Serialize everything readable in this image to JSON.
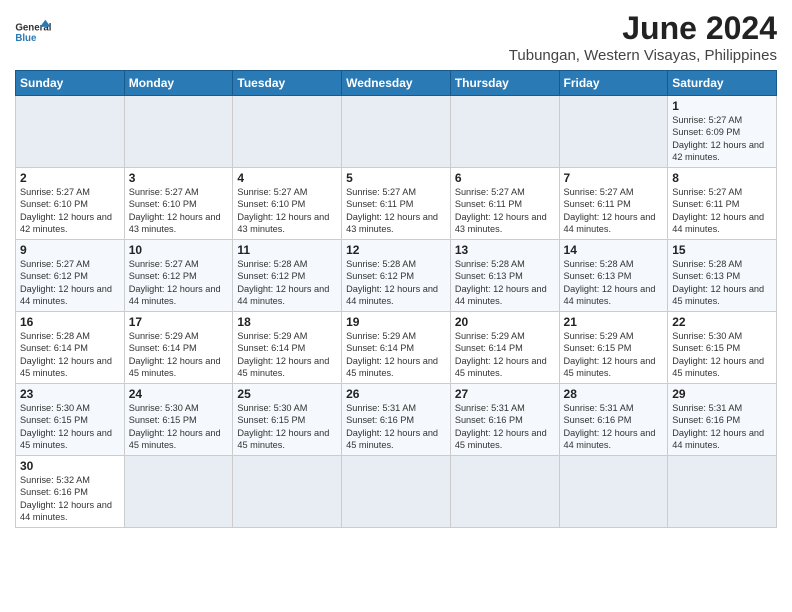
{
  "header": {
    "logo_general": "General",
    "logo_blue": "Blue",
    "month": "June 2024",
    "location": "Tubungan, Western Visayas, Philippines"
  },
  "days_of_week": [
    "Sunday",
    "Monday",
    "Tuesday",
    "Wednesday",
    "Thursday",
    "Friday",
    "Saturday"
  ],
  "weeks": [
    [
      {
        "day": "",
        "info": ""
      },
      {
        "day": "",
        "info": ""
      },
      {
        "day": "",
        "info": ""
      },
      {
        "day": "",
        "info": ""
      },
      {
        "day": "",
        "info": ""
      },
      {
        "day": "",
        "info": ""
      },
      {
        "day": "1",
        "info": "Sunrise: 5:27 AM\nSunset: 6:09 PM\nDaylight: 12 hours and 42 minutes."
      }
    ],
    [
      {
        "day": "2",
        "info": "Sunrise: 5:27 AM\nSunset: 6:10 PM\nDaylight: 12 hours and 42 minutes."
      },
      {
        "day": "3",
        "info": "Sunrise: 5:27 AM\nSunset: 6:10 PM\nDaylight: 12 hours and 43 minutes."
      },
      {
        "day": "4",
        "info": "Sunrise: 5:27 AM\nSunset: 6:10 PM\nDaylight: 12 hours and 43 minutes."
      },
      {
        "day": "5",
        "info": "Sunrise: 5:27 AM\nSunset: 6:11 PM\nDaylight: 12 hours and 43 minutes."
      },
      {
        "day": "6",
        "info": "Sunrise: 5:27 AM\nSunset: 6:11 PM\nDaylight: 12 hours and 43 minutes."
      },
      {
        "day": "7",
        "info": "Sunrise: 5:27 AM\nSunset: 6:11 PM\nDaylight: 12 hours and 44 minutes."
      },
      {
        "day": "8",
        "info": "Sunrise: 5:27 AM\nSunset: 6:11 PM\nDaylight: 12 hours and 44 minutes."
      }
    ],
    [
      {
        "day": "9",
        "info": "Sunrise: 5:27 AM\nSunset: 6:12 PM\nDaylight: 12 hours and 44 minutes."
      },
      {
        "day": "10",
        "info": "Sunrise: 5:27 AM\nSunset: 6:12 PM\nDaylight: 12 hours and 44 minutes."
      },
      {
        "day": "11",
        "info": "Sunrise: 5:28 AM\nSunset: 6:12 PM\nDaylight: 12 hours and 44 minutes."
      },
      {
        "day": "12",
        "info": "Sunrise: 5:28 AM\nSunset: 6:12 PM\nDaylight: 12 hours and 44 minutes."
      },
      {
        "day": "13",
        "info": "Sunrise: 5:28 AM\nSunset: 6:13 PM\nDaylight: 12 hours and 44 minutes."
      },
      {
        "day": "14",
        "info": "Sunrise: 5:28 AM\nSunset: 6:13 PM\nDaylight: 12 hours and 44 minutes."
      },
      {
        "day": "15",
        "info": "Sunrise: 5:28 AM\nSunset: 6:13 PM\nDaylight: 12 hours and 45 minutes."
      }
    ],
    [
      {
        "day": "16",
        "info": "Sunrise: 5:28 AM\nSunset: 6:14 PM\nDaylight: 12 hours and 45 minutes."
      },
      {
        "day": "17",
        "info": "Sunrise: 5:29 AM\nSunset: 6:14 PM\nDaylight: 12 hours and 45 minutes."
      },
      {
        "day": "18",
        "info": "Sunrise: 5:29 AM\nSunset: 6:14 PM\nDaylight: 12 hours and 45 minutes."
      },
      {
        "day": "19",
        "info": "Sunrise: 5:29 AM\nSunset: 6:14 PM\nDaylight: 12 hours and 45 minutes."
      },
      {
        "day": "20",
        "info": "Sunrise: 5:29 AM\nSunset: 6:14 PM\nDaylight: 12 hours and 45 minutes."
      },
      {
        "day": "21",
        "info": "Sunrise: 5:29 AM\nSunset: 6:15 PM\nDaylight: 12 hours and 45 minutes."
      },
      {
        "day": "22",
        "info": "Sunrise: 5:30 AM\nSunset: 6:15 PM\nDaylight: 12 hours and 45 minutes."
      }
    ],
    [
      {
        "day": "23",
        "info": "Sunrise: 5:30 AM\nSunset: 6:15 PM\nDaylight: 12 hours and 45 minutes."
      },
      {
        "day": "24",
        "info": "Sunrise: 5:30 AM\nSunset: 6:15 PM\nDaylight: 12 hours and 45 minutes."
      },
      {
        "day": "25",
        "info": "Sunrise: 5:30 AM\nSunset: 6:15 PM\nDaylight: 12 hours and 45 minutes."
      },
      {
        "day": "26",
        "info": "Sunrise: 5:31 AM\nSunset: 6:16 PM\nDaylight: 12 hours and 45 minutes."
      },
      {
        "day": "27",
        "info": "Sunrise: 5:31 AM\nSunset: 6:16 PM\nDaylight: 12 hours and 45 minutes."
      },
      {
        "day": "28",
        "info": "Sunrise: 5:31 AM\nSunset: 6:16 PM\nDaylight: 12 hours and 44 minutes."
      },
      {
        "day": "29",
        "info": "Sunrise: 5:31 AM\nSunset: 6:16 PM\nDaylight: 12 hours and 44 minutes."
      }
    ],
    [
      {
        "day": "30",
        "info": "Sunrise: 5:32 AM\nSunset: 6:16 PM\nDaylight: 12 hours and 44 minutes."
      },
      {
        "day": "",
        "info": ""
      },
      {
        "day": "",
        "info": ""
      },
      {
        "day": "",
        "info": ""
      },
      {
        "day": "",
        "info": ""
      },
      {
        "day": "",
        "info": ""
      },
      {
        "day": "",
        "info": ""
      }
    ]
  ]
}
